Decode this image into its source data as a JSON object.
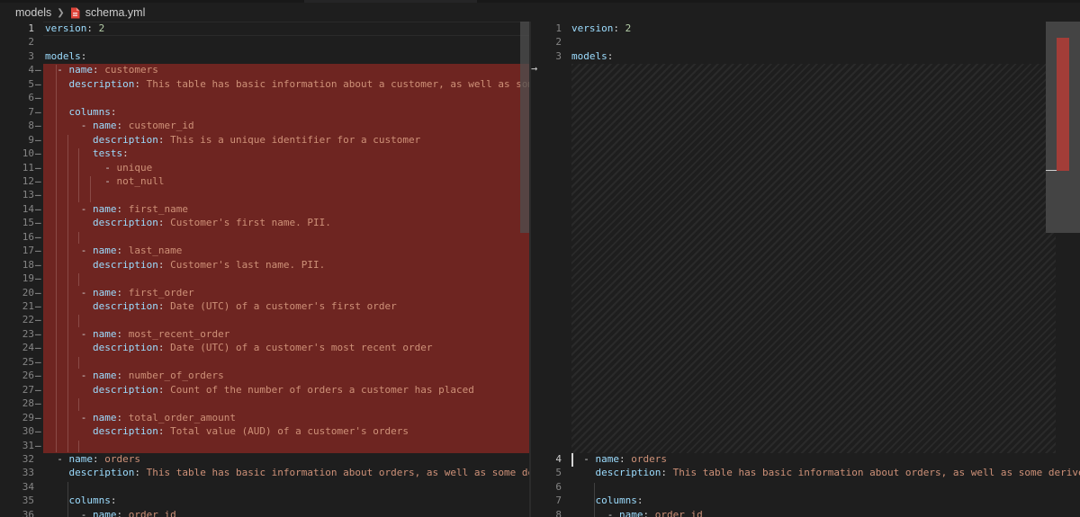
{
  "breadcrumb": {
    "folder": "models",
    "file": "schema.yml"
  },
  "left_lines": [
    {
      "n": "1",
      "c": [
        [
          "k",
          "version"
        ],
        [
          "p",
          ": "
        ],
        [
          "n",
          "2"
        ]
      ]
    },
    {
      "n": "2",
      "c": []
    },
    {
      "n": "3",
      "c": [
        [
          "k",
          "models"
        ],
        [
          "p",
          ":"
        ]
      ]
    },
    {
      "n": "4",
      "c": [
        [
          "p",
          "  - "
        ],
        [
          "k",
          "name"
        ],
        [
          "p",
          ": "
        ],
        [
          "v",
          "customers"
        ]
      ]
    },
    {
      "n": "5",
      "c": [
        [
          "p",
          "    "
        ],
        [
          "k",
          "description"
        ],
        [
          "p",
          ": "
        ],
        [
          "v",
          "This table has basic information about a customer, as well as some der"
        ]
      ]
    },
    {
      "n": "6",
      "c": []
    },
    {
      "n": "7",
      "c": [
        [
          "p",
          "    "
        ],
        [
          "k",
          "columns"
        ],
        [
          "p",
          ":"
        ]
      ]
    },
    {
      "n": "8",
      "c": [
        [
          "p",
          "      - "
        ],
        [
          "k",
          "name"
        ],
        [
          "p",
          ": "
        ],
        [
          "v",
          "customer_id"
        ]
      ]
    },
    {
      "n": "9",
      "c": [
        [
          "p",
          "        "
        ],
        [
          "k",
          "description"
        ],
        [
          "p",
          ": "
        ],
        [
          "v",
          "This is a unique identifier for a customer"
        ]
      ]
    },
    {
      "n": "10",
      "c": [
        [
          "p",
          "        "
        ],
        [
          "k",
          "tests"
        ],
        [
          "p",
          ":"
        ]
      ]
    },
    {
      "n": "11",
      "c": [
        [
          "p",
          "          - "
        ],
        [
          "v",
          "unique"
        ]
      ]
    },
    {
      "n": "12",
      "c": [
        [
          "p",
          "          - "
        ],
        [
          "v",
          "not_null"
        ]
      ]
    },
    {
      "n": "13",
      "c": []
    },
    {
      "n": "14",
      "c": [
        [
          "p",
          "      - "
        ],
        [
          "k",
          "name"
        ],
        [
          "p",
          ": "
        ],
        [
          "v",
          "first_name"
        ]
      ]
    },
    {
      "n": "15",
      "c": [
        [
          "p",
          "        "
        ],
        [
          "k",
          "description"
        ],
        [
          "p",
          ": "
        ],
        [
          "v",
          "Customer's first name. PII."
        ]
      ]
    },
    {
      "n": "16",
      "c": []
    },
    {
      "n": "17",
      "c": [
        [
          "p",
          "      - "
        ],
        [
          "k",
          "name"
        ],
        [
          "p",
          ": "
        ],
        [
          "v",
          "last_name"
        ]
      ]
    },
    {
      "n": "18",
      "c": [
        [
          "p",
          "        "
        ],
        [
          "k",
          "description"
        ],
        [
          "p",
          ": "
        ],
        [
          "v",
          "Customer's last name. PII."
        ]
      ]
    },
    {
      "n": "19",
      "c": []
    },
    {
      "n": "20",
      "c": [
        [
          "p",
          "      - "
        ],
        [
          "k",
          "name"
        ],
        [
          "p",
          ": "
        ],
        [
          "v",
          "first_order"
        ]
      ]
    },
    {
      "n": "21",
      "c": [
        [
          "p",
          "        "
        ],
        [
          "k",
          "description"
        ],
        [
          "p",
          ": "
        ],
        [
          "v",
          "Date (UTC) of a customer's first order"
        ]
      ]
    },
    {
      "n": "22",
      "c": []
    },
    {
      "n": "23",
      "c": [
        [
          "p",
          "      - "
        ],
        [
          "k",
          "name"
        ],
        [
          "p",
          ": "
        ],
        [
          "v",
          "most_recent_order"
        ]
      ]
    },
    {
      "n": "24",
      "c": [
        [
          "p",
          "        "
        ],
        [
          "k",
          "description"
        ],
        [
          "p",
          ": "
        ],
        [
          "v",
          "Date (UTC) of a customer's most recent order"
        ]
      ]
    },
    {
      "n": "25",
      "c": []
    },
    {
      "n": "26",
      "c": [
        [
          "p",
          "      - "
        ],
        [
          "k",
          "name"
        ],
        [
          "p",
          ": "
        ],
        [
          "v",
          "number_of_orders"
        ]
      ]
    },
    {
      "n": "27",
      "c": [
        [
          "p",
          "        "
        ],
        [
          "k",
          "description"
        ],
        [
          "p",
          ": "
        ],
        [
          "v",
          "Count of the number of orders a customer has placed"
        ]
      ]
    },
    {
      "n": "28",
      "c": []
    },
    {
      "n": "29",
      "c": [
        [
          "p",
          "      - "
        ],
        [
          "k",
          "name"
        ],
        [
          "p",
          ": "
        ],
        [
          "v",
          "total_order_amount"
        ]
      ]
    },
    {
      "n": "30",
      "c": [
        [
          "p",
          "        "
        ],
        [
          "k",
          "description"
        ],
        [
          "p",
          ": "
        ],
        [
          "v",
          "Total value (AUD) of a customer's orders"
        ]
      ]
    },
    {
      "n": "31",
      "c": []
    },
    {
      "n": "32",
      "c": [
        [
          "p",
          "  - "
        ],
        [
          "k",
          "name"
        ],
        [
          "p",
          ": "
        ],
        [
          "v",
          "orders"
        ]
      ]
    },
    {
      "n": "33",
      "c": [
        [
          "p",
          "    "
        ],
        [
          "k",
          "description"
        ],
        [
          "p",
          ": "
        ],
        [
          "v",
          "This table has basic information about orders, as well as some derived"
        ]
      ]
    },
    {
      "n": "34",
      "c": []
    },
    {
      "n": "35",
      "c": [
        [
          "p",
          "    "
        ],
        [
          "k",
          "columns"
        ],
        [
          "p",
          ":"
        ]
      ]
    },
    {
      "n": "36",
      "c": [
        [
          "p",
          "      - "
        ],
        [
          "k",
          "name"
        ],
        [
          "p",
          ": "
        ],
        [
          "v",
          "order_id"
        ]
      ]
    }
  ],
  "right_lines_top": [
    {
      "n": "1",
      "c": [
        [
          "k",
          "version"
        ],
        [
          "p",
          ": "
        ],
        [
          "n",
          "2"
        ]
      ]
    },
    {
      "n": "2",
      "c": []
    },
    {
      "n": "3",
      "c": [
        [
          "k",
          "models"
        ],
        [
          "p",
          ":"
        ]
      ]
    }
  ],
  "right_lines_bottom": [
    {
      "n": "4",
      "c": [
        [
          "p",
          "  - "
        ],
        [
          "k",
          "name"
        ],
        [
          "p",
          ": "
        ],
        [
          "v",
          "orders"
        ]
      ]
    },
    {
      "n": "5",
      "c": [
        [
          "p",
          "    "
        ],
        [
          "k",
          "description"
        ],
        [
          "p",
          ": "
        ],
        [
          "v",
          "This table has basic information about orders, as well as some derived"
        ]
      ]
    },
    {
      "n": "6",
      "c": []
    },
    {
      "n": "7",
      "c": [
        [
          "p",
          "    "
        ],
        [
          "k",
          "columns"
        ],
        [
          "p",
          ":"
        ]
      ]
    },
    {
      "n": "8",
      "c": [
        [
          "p",
          "      - "
        ],
        [
          "k",
          "name"
        ],
        [
          "p",
          ": "
        ],
        [
          "v",
          "order_id"
        ]
      ]
    }
  ],
  "arrow_glyph": "→",
  "colors": {
    "removed": "#6e2521",
    "key": "#9cdcfe",
    "value": "#ce9178",
    "number": "#b5cea8"
  }
}
